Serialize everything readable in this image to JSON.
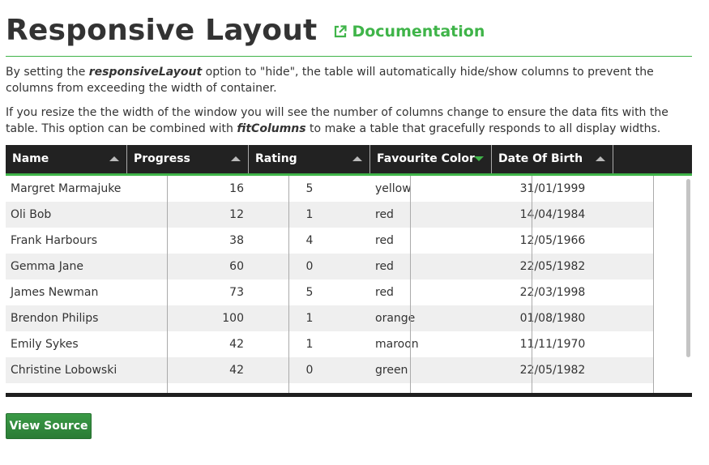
{
  "header": {
    "title": "Responsive Layout",
    "doc_link": "Documentation",
    "doc_icon": "external-link-icon",
    "accent_color": "#3fb449"
  },
  "description": {
    "p1_a": "By setting the ",
    "p1_em": "responsiveLayout",
    "p1_b": " option to \"hide\", the table will automatically hide/show columns to prevent the columns from exceeding the width of container.",
    "p2_a": "If you resize the the width of the window you will see the number of columns change to ensure the data fits with the table. This option can be combined with ",
    "p2_em": "fitColumns",
    "p2_b": " to make a table that gracefully responds to all display widths."
  },
  "table": {
    "columns": [
      {
        "label": "Name",
        "sort": "up"
      },
      {
        "label": "Progress",
        "sort": "up"
      },
      {
        "label": "Rating",
        "sort": "up"
      },
      {
        "label": "Favourite Color",
        "sort": "down"
      },
      {
        "label": "Date Of Birth",
        "sort": "up"
      }
    ],
    "rows": [
      [
        "Margret Marmajuke",
        "16",
        "5",
        "yellow",
        "31/01/1999"
      ],
      [
        "Oli Bob",
        "12",
        "1",
        "red",
        "14/04/1984"
      ],
      [
        "Frank Harbours",
        "38",
        "4",
        "red",
        "12/05/1966"
      ],
      [
        "Gemma Jane",
        "60",
        "0",
        "red",
        "22/05/1982"
      ],
      [
        "James Newman",
        "73",
        "5",
        "red",
        "22/03/1998"
      ],
      [
        "Brendon Philips",
        "100",
        "1",
        "orange",
        "01/08/1980"
      ],
      [
        "Emily Sykes",
        "42",
        "1",
        "maroon",
        "11/11/1970"
      ],
      [
        "Christine Lobowski",
        "42",
        "0",
        "green",
        "22/05/1982"
      ]
    ]
  },
  "footer": {
    "view_source_label": "View Source",
    "button_color": "#2f8a3b"
  }
}
